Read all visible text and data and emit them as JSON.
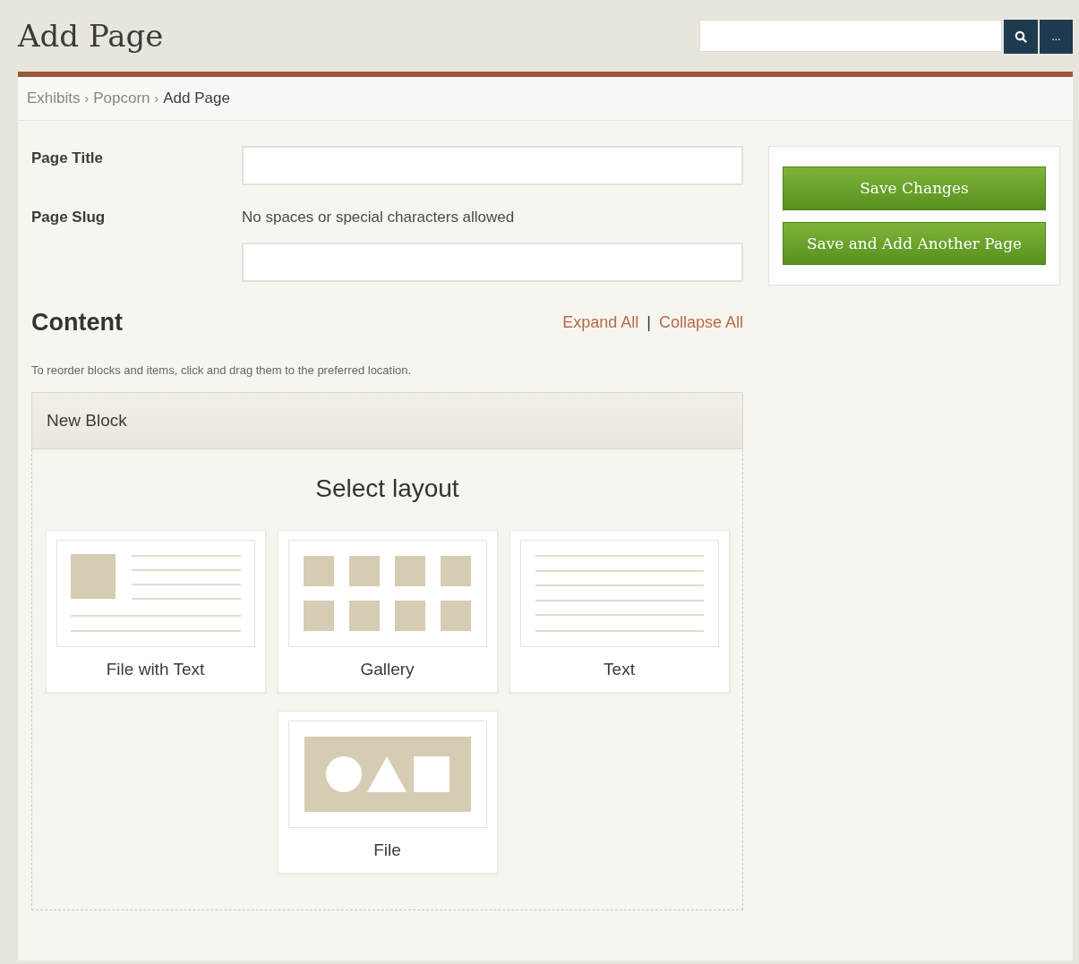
{
  "header": {
    "title": "Add Page",
    "search": {
      "more_label": "..."
    }
  },
  "breadcrumb": {
    "separator": "›",
    "items": [
      "Exhibits",
      "Popcorn",
      "Add Page"
    ]
  },
  "form": {
    "fields": [
      {
        "label": "Page Title"
      },
      {
        "label": "Page Slug",
        "hint": "No spaces or special characters allowed"
      }
    ]
  },
  "content": {
    "heading": "Content",
    "expand_label": "Expand All",
    "divider": "|",
    "collapse_label": "Collapse All",
    "instructions": "To reorder blocks and items, click and drag them to the preferred location.",
    "block": {
      "title": "New Block",
      "layout_heading": "Select layout",
      "layouts": [
        {
          "kind": "file-text",
          "label": "File with Text"
        },
        {
          "kind": "gallery",
          "label": "Gallery"
        },
        {
          "kind": "text",
          "label": "Text"
        },
        {
          "kind": "file",
          "label": "File"
        }
      ]
    }
  },
  "actions": [
    "Save Changes",
    "Save and Add Another Page"
  ]
}
